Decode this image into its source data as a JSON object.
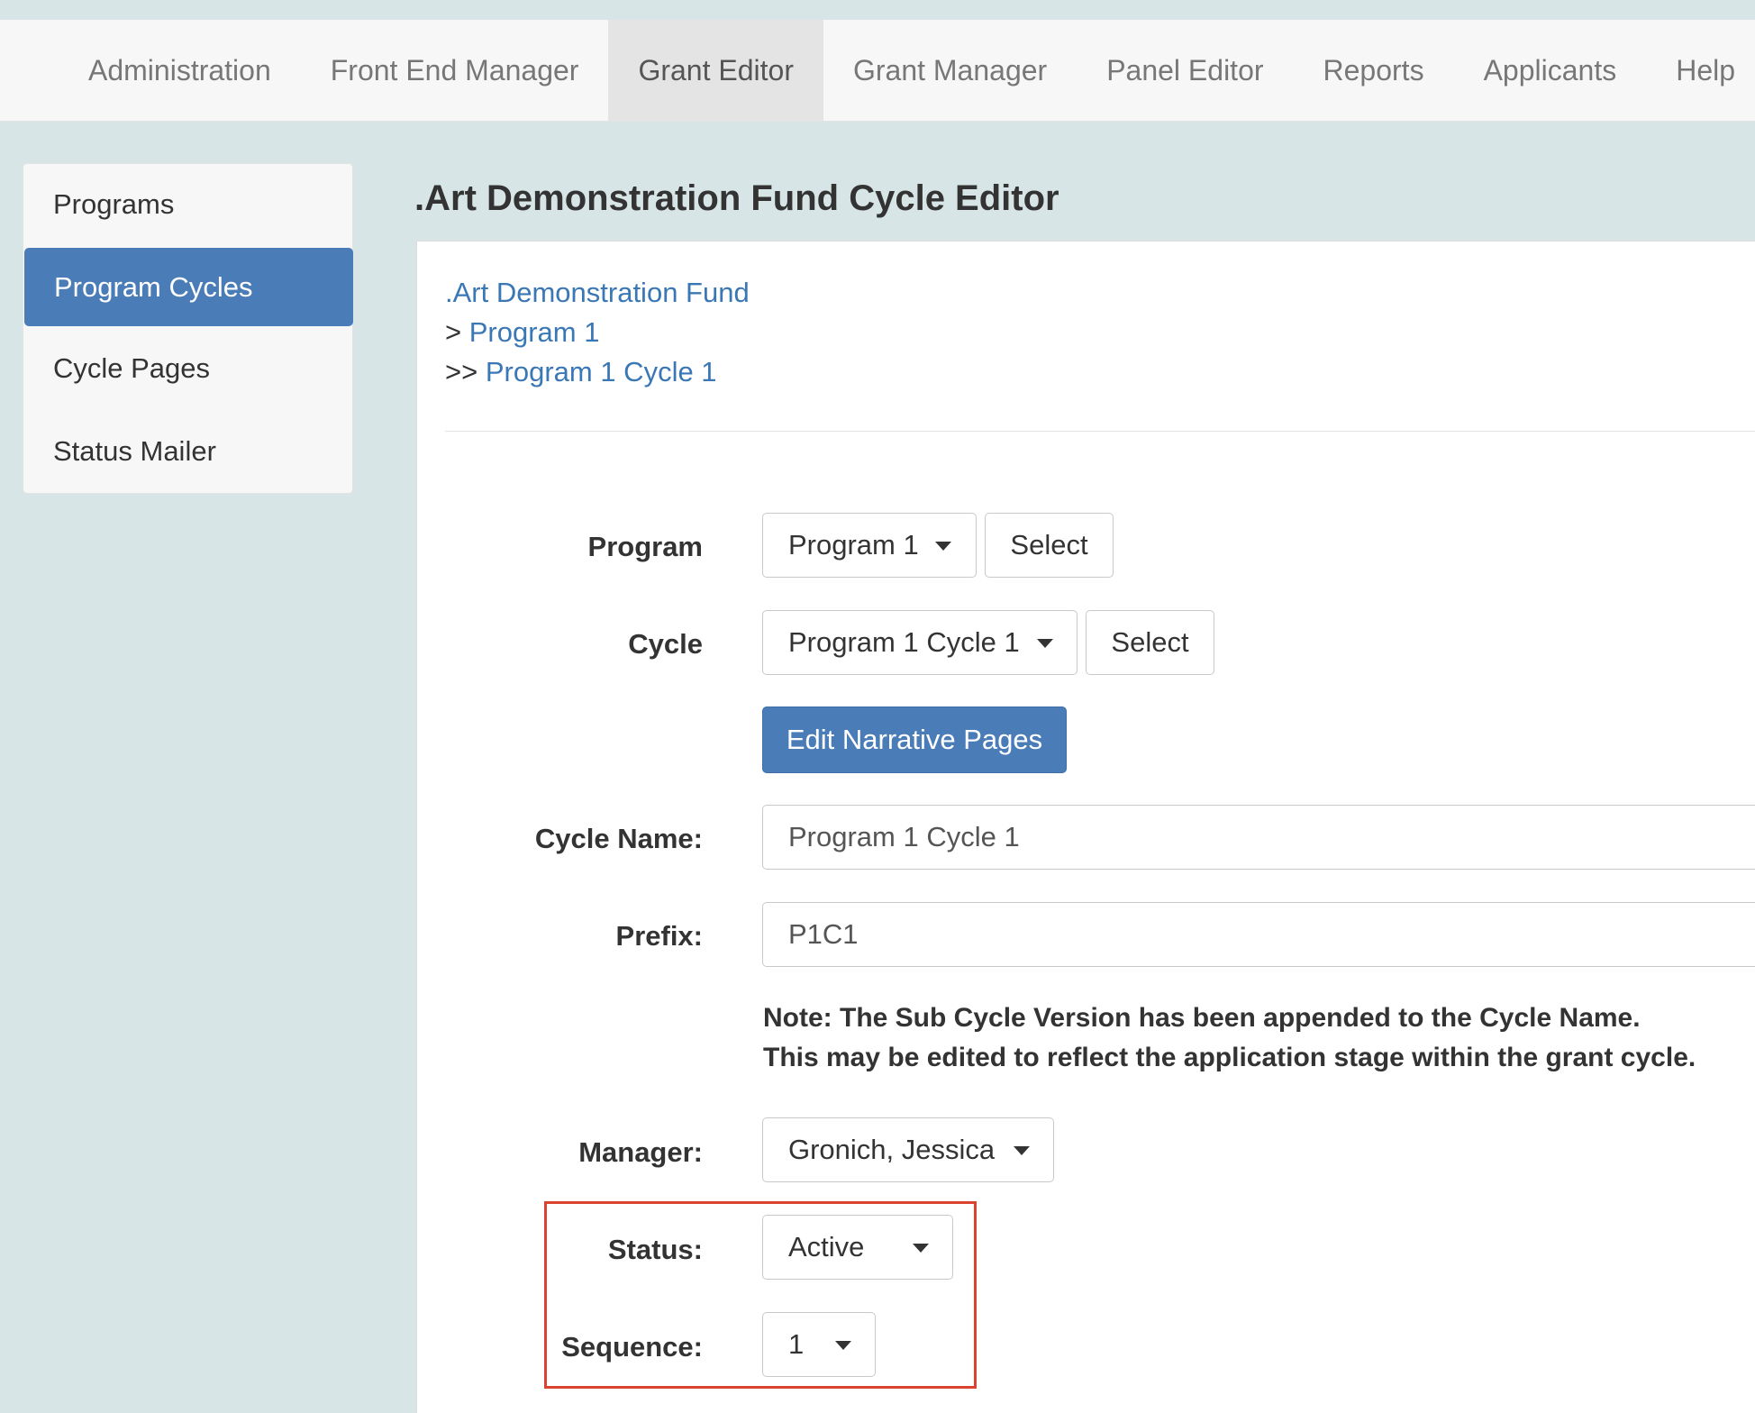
{
  "nav": {
    "items": [
      {
        "label": "Administration"
      },
      {
        "label": "Front End Manager"
      },
      {
        "label": "Grant Editor",
        "active": true
      },
      {
        "label": "Grant Manager"
      },
      {
        "label": "Panel Editor"
      },
      {
        "label": "Reports"
      },
      {
        "label": "Applicants"
      },
      {
        "label": "Help"
      }
    ]
  },
  "sidebar": {
    "items": [
      {
        "label": "Programs"
      },
      {
        "label": "Program Cycles",
        "active": true
      },
      {
        "label": "Cycle Pages"
      },
      {
        "label": "Status Mailer"
      }
    ]
  },
  "page": {
    "title": ".Art Demonstration Fund Cycle Editor"
  },
  "breadcrumb": {
    "fund": ".Art Demonstration Fund",
    "program_prefix": ">",
    "program": "Program 1",
    "cycle_prefix": ">>",
    "cycle": "Program 1 Cycle 1"
  },
  "form": {
    "program_label": "Program",
    "program_value": "Program 1",
    "program_select_button": "Select",
    "cycle_label": "Cycle",
    "cycle_value": "Program 1 Cycle 1",
    "cycle_select_button": "Select",
    "edit_narrative_button": "Edit Narrative Pages",
    "cycle_name_label": "Cycle Name:",
    "cycle_name_value": "Program 1 Cycle 1",
    "prefix_label": "Prefix:",
    "prefix_value": "P1C1",
    "note_line1": "Note: The Sub Cycle Version has been appended to the Cycle Name.",
    "note_line2": "This may be edited to reflect the application stage within the grant cycle.",
    "manager_label": "Manager:",
    "manager_value": "Gronich, Jessica",
    "status_label": "Status:",
    "status_value": "Active",
    "sequence_label": "Sequence:",
    "sequence_value": "1"
  },
  "colors": {
    "accent": "#4a7cb8",
    "link": "#3a77b5",
    "highlight_border": "#d9432f",
    "background": "#d7e5e6"
  },
  "icons": {
    "dropdown": "caret-down-icon"
  }
}
